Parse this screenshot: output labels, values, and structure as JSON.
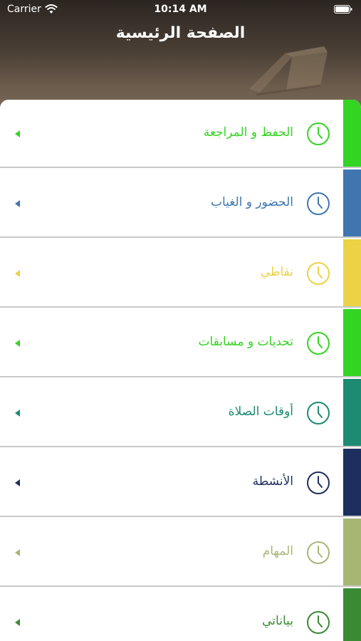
{
  "status_bar": {
    "carrier": "Carrier",
    "time": "10:14 AM"
  },
  "header": {
    "title": "الصفحة الرئيسية"
  },
  "menu": {
    "items": [
      {
        "label": "الحفظ و المراجعة",
        "color": "#34d423",
        "icon": "clock-icon"
      },
      {
        "label": "الحضور و الغياب",
        "color": "#3f76b0",
        "icon": "clock-icon"
      },
      {
        "label": "نقاطي",
        "color": "#ecd244",
        "icon": "clock-icon"
      },
      {
        "label": "تحديات و مسابقات",
        "color": "#34d423",
        "icon": "clock-icon"
      },
      {
        "label": "أوقات الصلاة",
        "color": "#1d8a72",
        "icon": "clock-icon"
      },
      {
        "label": "الأنشطة",
        "color": "#1e2e5e",
        "icon": "clock-icon"
      },
      {
        "label": "المهام",
        "color": "#a8b674",
        "icon": "clock-icon"
      },
      {
        "label": "بياناتي",
        "color": "#3a8a34",
        "icon": "clock-icon"
      }
    ]
  }
}
